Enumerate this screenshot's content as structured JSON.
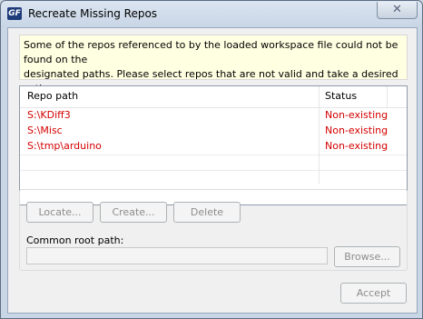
{
  "window": {
    "title": "Recreate Missing Repos",
    "icon_text": "GF",
    "close_glyph": "✕"
  },
  "banner": {
    "line1": "Some of the repos referenced to by the loaded workspace file could not be found on the",
    "line2": "designated paths. Please select repos that are not valid and take a desired action."
  },
  "table": {
    "headers": {
      "path": "Repo path",
      "status": "Status"
    },
    "rows": [
      {
        "path": "S:\\KDiff3",
        "status": "Non-existing"
      },
      {
        "path": "S:\\Misc",
        "status": "Non-existing"
      },
      {
        "path": "S:\\tmp\\arduino",
        "status": "Non-existing"
      }
    ],
    "row_color": "#d40000"
  },
  "actions": {
    "locate": "Locate...",
    "create": "Create...",
    "delete": "Delete"
  },
  "common_root": {
    "label": "Common root path:",
    "value": "",
    "browse": "Browse..."
  },
  "footer": {
    "accept": "Accept"
  }
}
